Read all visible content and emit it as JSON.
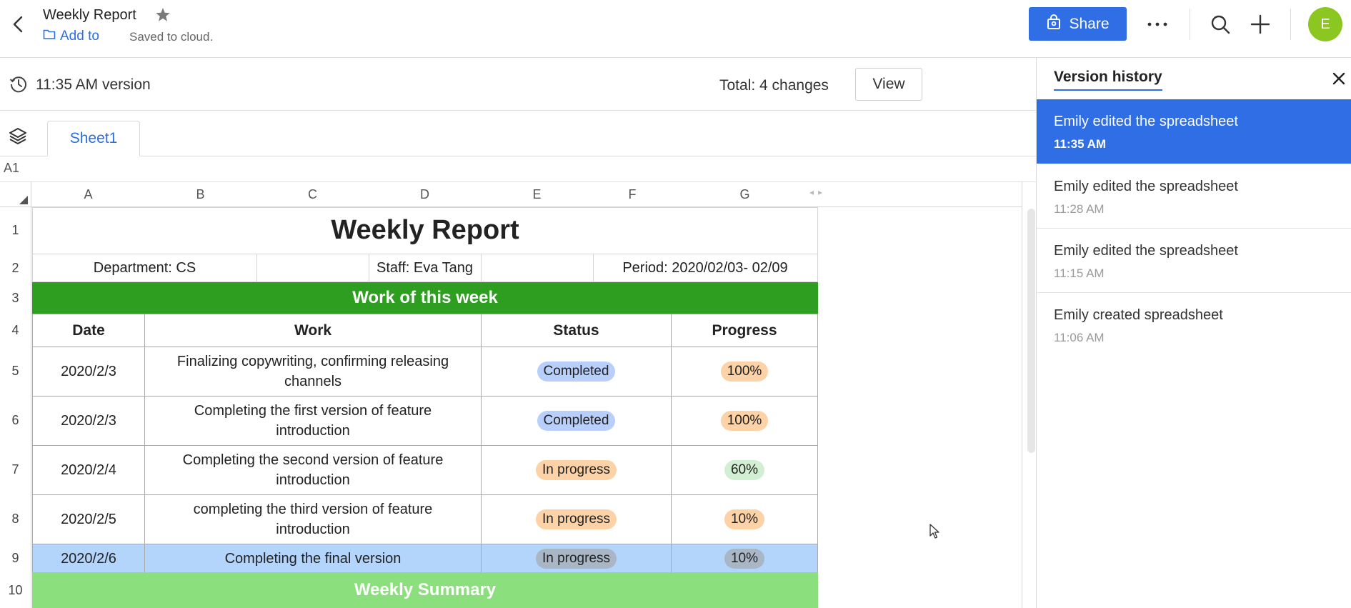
{
  "header": {
    "title": "Weekly Report",
    "add_to": "Add to",
    "saved_status": "Saved to cloud.",
    "share_label": "Share",
    "avatar_initial": "E"
  },
  "version_bar": {
    "version_label": "11:35 AM version",
    "total_changes": "Total: 4 changes",
    "view_label": "View"
  },
  "sheet": {
    "tab_label": "Sheet1",
    "cell_ref": "A1",
    "columns": [
      "A",
      "B",
      "C",
      "D",
      "E",
      "F",
      "G"
    ],
    "rows": [
      "1",
      "2",
      "3",
      "4",
      "5",
      "6",
      "7",
      "8",
      "9",
      "10"
    ],
    "title": "Weekly Report",
    "department": "Department: CS",
    "staff": "Staff: Eva Tang",
    "period": "Period:  2020/02/03- 02/09",
    "section_header": "Work of this week",
    "table_headers": {
      "date": "Date",
      "work": "Work",
      "status": "Status",
      "progress": "Progress"
    },
    "table_rows": [
      {
        "date": "2020/2/3",
        "work": "Finalizing copywriting, confirming releasing channels",
        "status": "Completed",
        "progress": "100%"
      },
      {
        "date": "2020/2/3",
        "work": "Completing the first version of feature introduction",
        "status": "Completed",
        "progress": "100%"
      },
      {
        "date": "2020/2/4",
        "work": "Completing the second version of feature introduction",
        "status": "In progress",
        "progress": "60%"
      },
      {
        "date": "2020/2/5",
        "work": "completing the third version of feature introduction",
        "status": "In progress",
        "progress": "10%"
      },
      {
        "date": "2020/2/6",
        "work": "Completing the final version",
        "status": "In progress",
        "progress": "10%"
      }
    ],
    "summary_header": "Weekly Summary"
  },
  "version_history": {
    "title": "Version history",
    "items": [
      {
        "title": "Emily edited the spreadsheet",
        "time": "11:35 AM"
      },
      {
        "title": "Emily edited the spreadsheet",
        "time": "11:28 AM"
      },
      {
        "title": "Emily edited the spreadsheet",
        "time": "11:15 AM"
      },
      {
        "title": "Emily created spreadsheet",
        "time": "11:06 AM"
      }
    ]
  },
  "colors": {
    "accent": "#2f6ee5",
    "section_green": "#2d9e1f",
    "summary_green": "#8be07d",
    "selection": "#b3d4fb",
    "completed_pill": "#b9cffb",
    "in_progress_pill": "#fcd2a6",
    "progress_full_pill": "#fcd2a6",
    "progress_partial_pill": "#d3efd3",
    "avatar": "#8bc621"
  },
  "icons": [
    "back-icon",
    "star-icon",
    "folder-icon",
    "bag-icon",
    "more-icon",
    "search-icon",
    "plus-icon",
    "clock-icon",
    "layers-icon",
    "close-icon"
  ]
}
